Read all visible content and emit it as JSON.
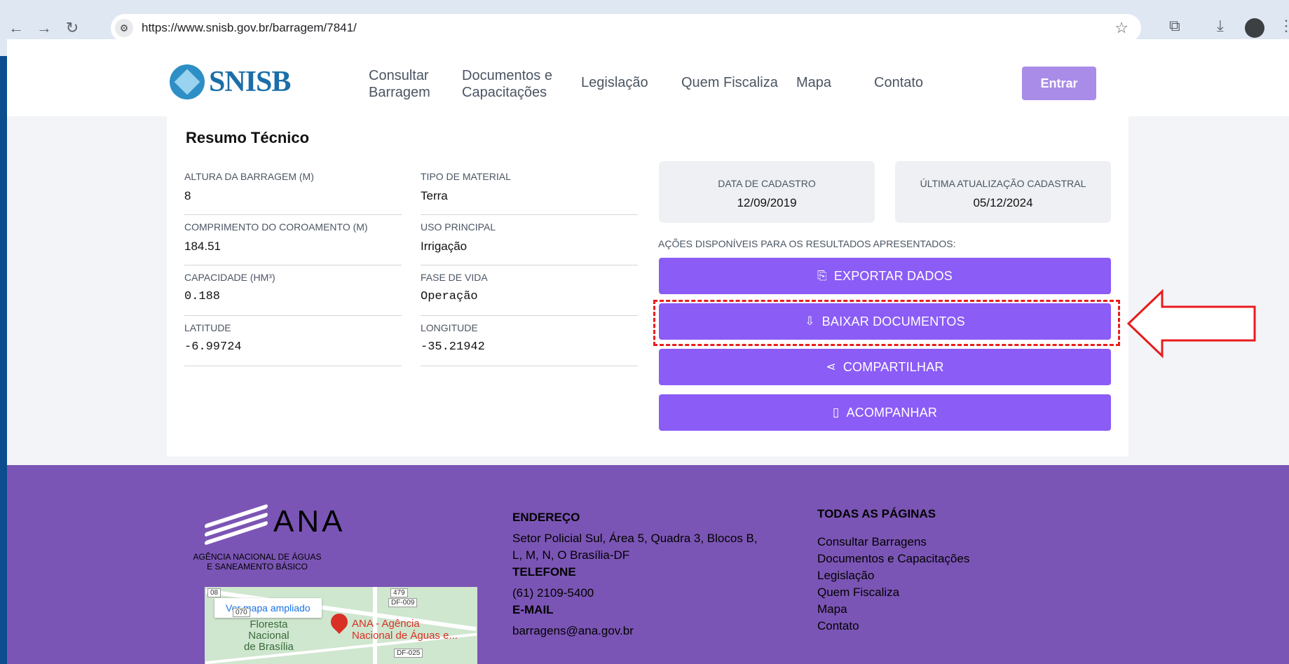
{
  "browser": {
    "url": "https://www.snisb.gov.br/barragem/7841/"
  },
  "header": {
    "logo_text": "SNISB",
    "nav": [
      {
        "label": "Consultar\nBarragem"
      },
      {
        "label": "Documentos e\nCapacitações"
      },
      {
        "label": "Legislação"
      },
      {
        "label": "Quem Fiscaliza"
      },
      {
        "label": "Mapa"
      },
      {
        "label": "Contato"
      }
    ],
    "login_label": "Entrar"
  },
  "summary": {
    "title": "Resumo Técnico",
    "fields": {
      "altura_label": "ALTURA DA BARRAGEM (M)",
      "altura_value": "8",
      "material_label": "TIPO DE MATERIAL",
      "material_value": "Terra",
      "comprimento_label": "COMPRIMENTO DO COROAMENTO (M)",
      "comprimento_value": "184.51",
      "uso_label": "USO PRINCIPAL",
      "uso_value": "Irrigação",
      "capacidade_label": "CAPACIDADE (HM³)",
      "capacidade_value": "0.188",
      "fase_label": "FASE DE VIDA",
      "fase_value": "Operação",
      "latitude_label": "LATITUDE",
      "latitude_value": "-6.99724",
      "longitude_label": "LONGITUDE",
      "longitude_value": "-35.21942"
    },
    "data_cadastro_label": "DATA DE CADASTRO",
    "data_cadastro_value": "12/09/2019",
    "ultima_label": "ÚLTIMA ATUALIZAÇÃO CADASTRAL",
    "ultima_value": "05/12/2024",
    "acoes_label": "AÇÕES DISPONÍVEIS PARA OS RESULTADOS APRESENTADOS:",
    "actions": {
      "exportar": "EXPORTAR DADOS",
      "baixar": "BAIXAR DOCUMENTOS",
      "compartilhar": "COMPARTILHAR",
      "acompanhar": "ACOMPANHAR"
    }
  },
  "footer": {
    "ana_logo": "ANA",
    "ana_sub": "AGÊNCIA NACIONAL DE ÁGUAS\nE SANEAMENTO BÁSICO",
    "map": {
      "ver_mapa": "Ver mapa ampliado",
      "place_left": "Floresta\nNacional\nde Brasília",
      "place_pin": "ANA - Agência\nNacional de Águas e...",
      "road_tags": [
        "479",
        "DF-009",
        "070",
        "DF-025",
        "08"
      ]
    },
    "endereco_h": "ENDEREÇO",
    "endereco": "Setor Policial Sul, Área 5, Quadra 3, Blocos B,\nL, M, N, O Brasília-DF",
    "telefone_h": "TELEFONE",
    "telefone": "(61) 2109-5400",
    "email_h": "E-MAIL",
    "email": "barragens@ana.gov.br",
    "todas_h": "TODAS AS PÁGINAS",
    "links": [
      "Consultar Barragens",
      "Documentos e Capacitações",
      "Legislação",
      "Quem Fiscaliza",
      "Mapa",
      "Contato"
    ]
  },
  "colors": {
    "action": "#8b5cf6",
    "footer": "#7b55b5",
    "highlight": "#e81c1c"
  }
}
